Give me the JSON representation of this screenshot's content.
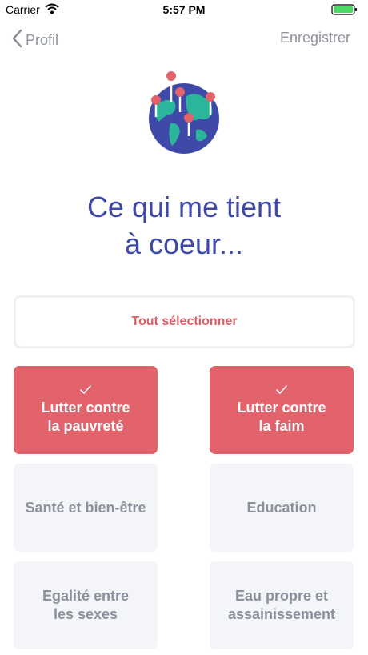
{
  "status_bar": {
    "carrier": "Carrier",
    "time": "5:57 PM"
  },
  "nav": {
    "back_label": "Profil",
    "save_label": "Enregistrer"
  },
  "title": {
    "line1": "Ce qui me tient",
    "line2": "à coeur..."
  },
  "select_all": {
    "label": "Tout sélectionner"
  },
  "colors": {
    "accent": "#e2636b",
    "title": "#3f4aa8",
    "inactive_bg": "#f3f5f8",
    "inactive_text": "#8b929d"
  },
  "causes": [
    {
      "label_line1": "Lutter contre",
      "label_line2": "la pauvreté",
      "selected": true
    },
    {
      "label_line1": "Lutter contre",
      "label_line2": "la faim",
      "selected": true
    },
    {
      "label_line1": "Santé et bien-être",
      "label_line2": "",
      "selected": false
    },
    {
      "label_line1": "Education",
      "label_line2": "",
      "selected": false
    },
    {
      "label_line1": "Egalité entre",
      "label_line2": "les sexes",
      "selected": false
    },
    {
      "label_line1": "Eau propre et",
      "label_line2": "assainissement",
      "selected": false
    }
  ]
}
